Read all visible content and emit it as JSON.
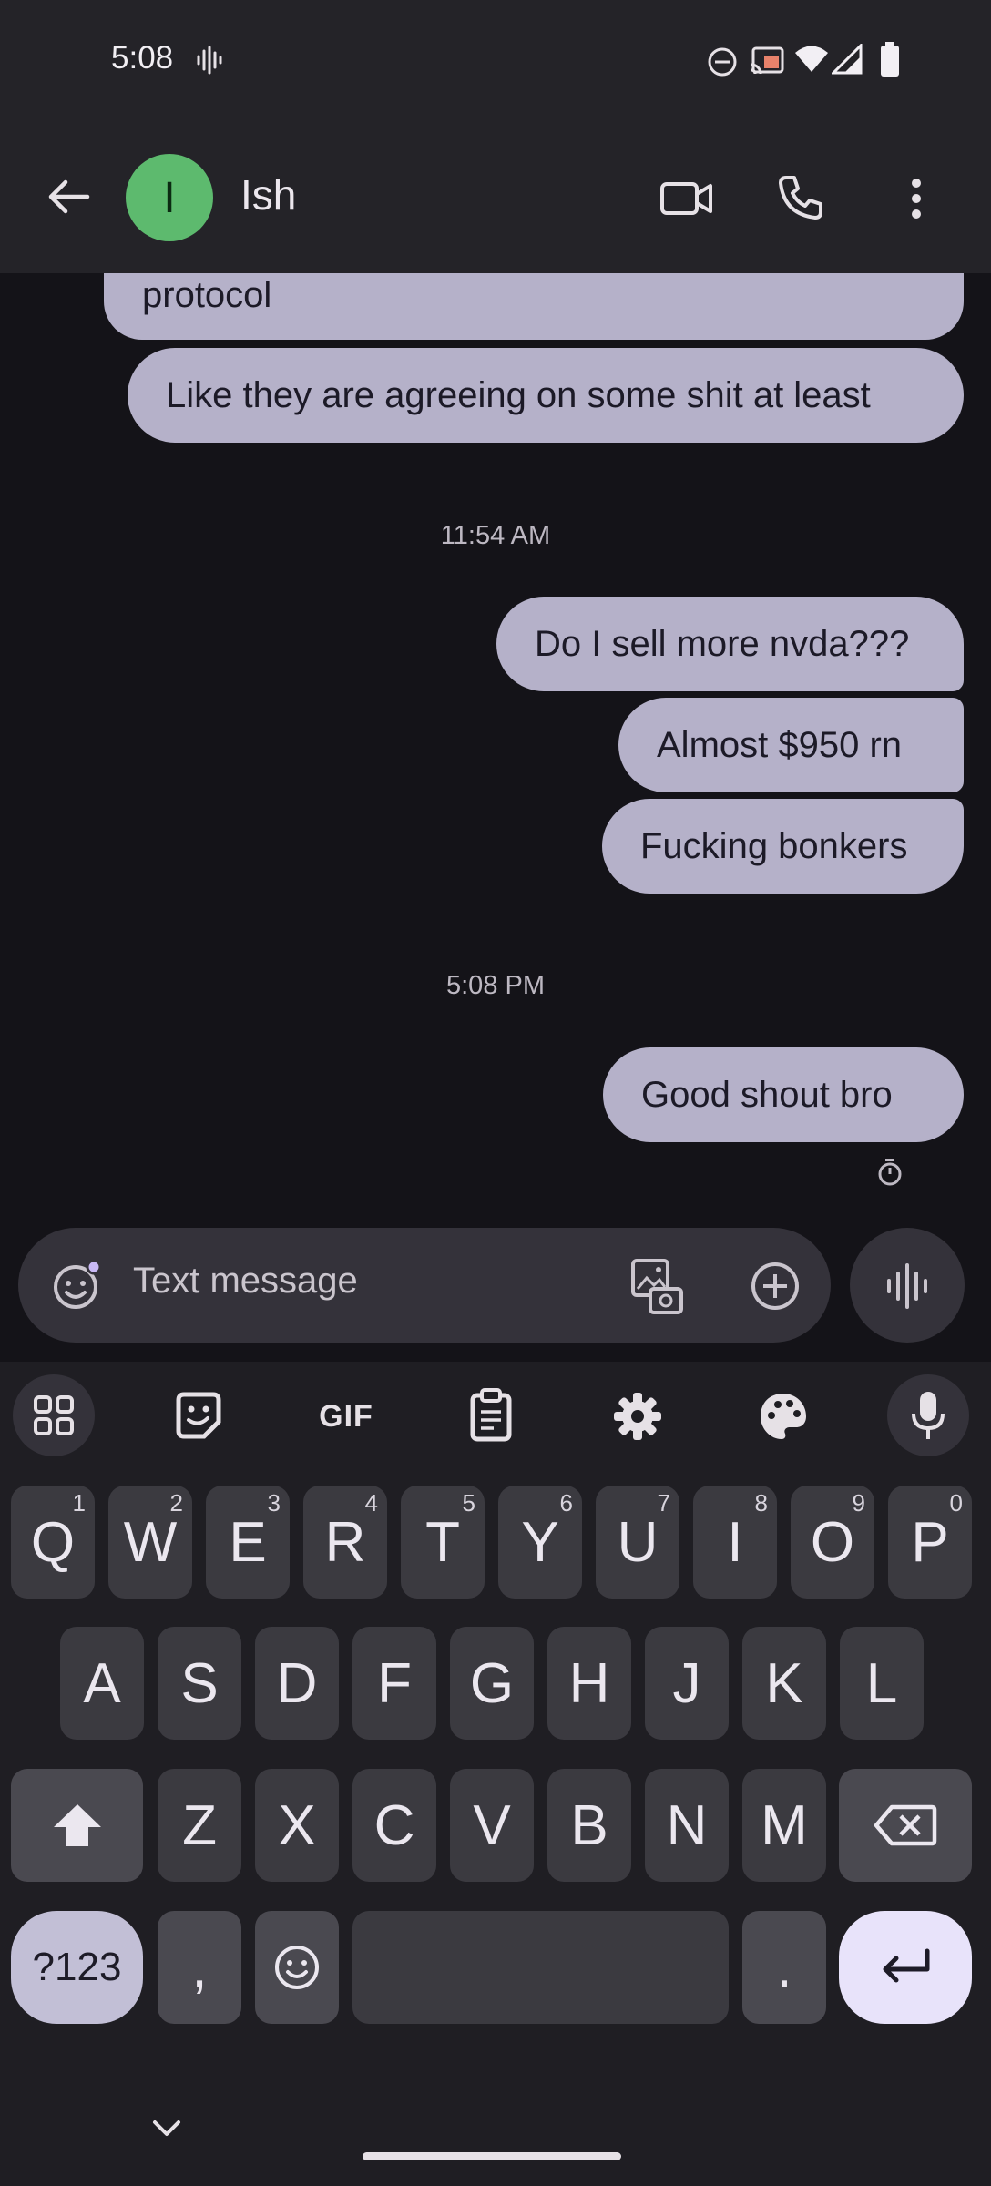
{
  "status_bar": {
    "time": "5:08"
  },
  "app_bar": {
    "contact_initial": "I",
    "contact_name": "Ish"
  },
  "messages": [
    {
      "text": "protocol"
    },
    {
      "text": "Like they are agreeing on some shit at least"
    },
    {
      "text": "Do I sell more nvda???"
    },
    {
      "text": "Almost $950 rn"
    },
    {
      "text": "Fucking bonkers"
    },
    {
      "text": "Good shout bro"
    }
  ],
  "timestamps": [
    "11:54 AM",
    "5:08 PM"
  ],
  "composer": {
    "placeholder": "Text message"
  },
  "keyboard": {
    "toolbar_gif": "GIF",
    "row1": [
      {
        "label": "Q",
        "sup": "1"
      },
      {
        "label": "W",
        "sup": "2"
      },
      {
        "label": "E",
        "sup": "3"
      },
      {
        "label": "R",
        "sup": "4"
      },
      {
        "label": "T",
        "sup": "5"
      },
      {
        "label": "Y",
        "sup": "6"
      },
      {
        "label": "U",
        "sup": "7"
      },
      {
        "label": "I",
        "sup": "8"
      },
      {
        "label": "O",
        "sup": "9"
      },
      {
        "label": "P",
        "sup": "0"
      }
    ],
    "row2": [
      "A",
      "S",
      "D",
      "F",
      "G",
      "H",
      "J",
      "K",
      "L"
    ],
    "row3": [
      "Z",
      "X",
      "C",
      "V",
      "B",
      "N",
      "M"
    ],
    "symbols_label": "?123",
    "comma": ",",
    "period": "."
  },
  "colors": {
    "bubble": "#b5b1c9",
    "avatar": "#5dba6e",
    "enter_key": "#e8e3fa"
  },
  "icons": [
    "back-arrow-icon",
    "video-call-icon",
    "phone-icon",
    "more-vert-icon",
    "emoji-icon",
    "gallery-icon",
    "add-icon",
    "voice-waveform-icon",
    "apps-grid-icon",
    "sticker-icon",
    "clipboard-icon",
    "settings-gear-icon",
    "palette-icon",
    "microphone-icon",
    "shift-icon",
    "backspace-icon",
    "emoji-key-icon",
    "enter-icon",
    "chevron-down-icon"
  ]
}
